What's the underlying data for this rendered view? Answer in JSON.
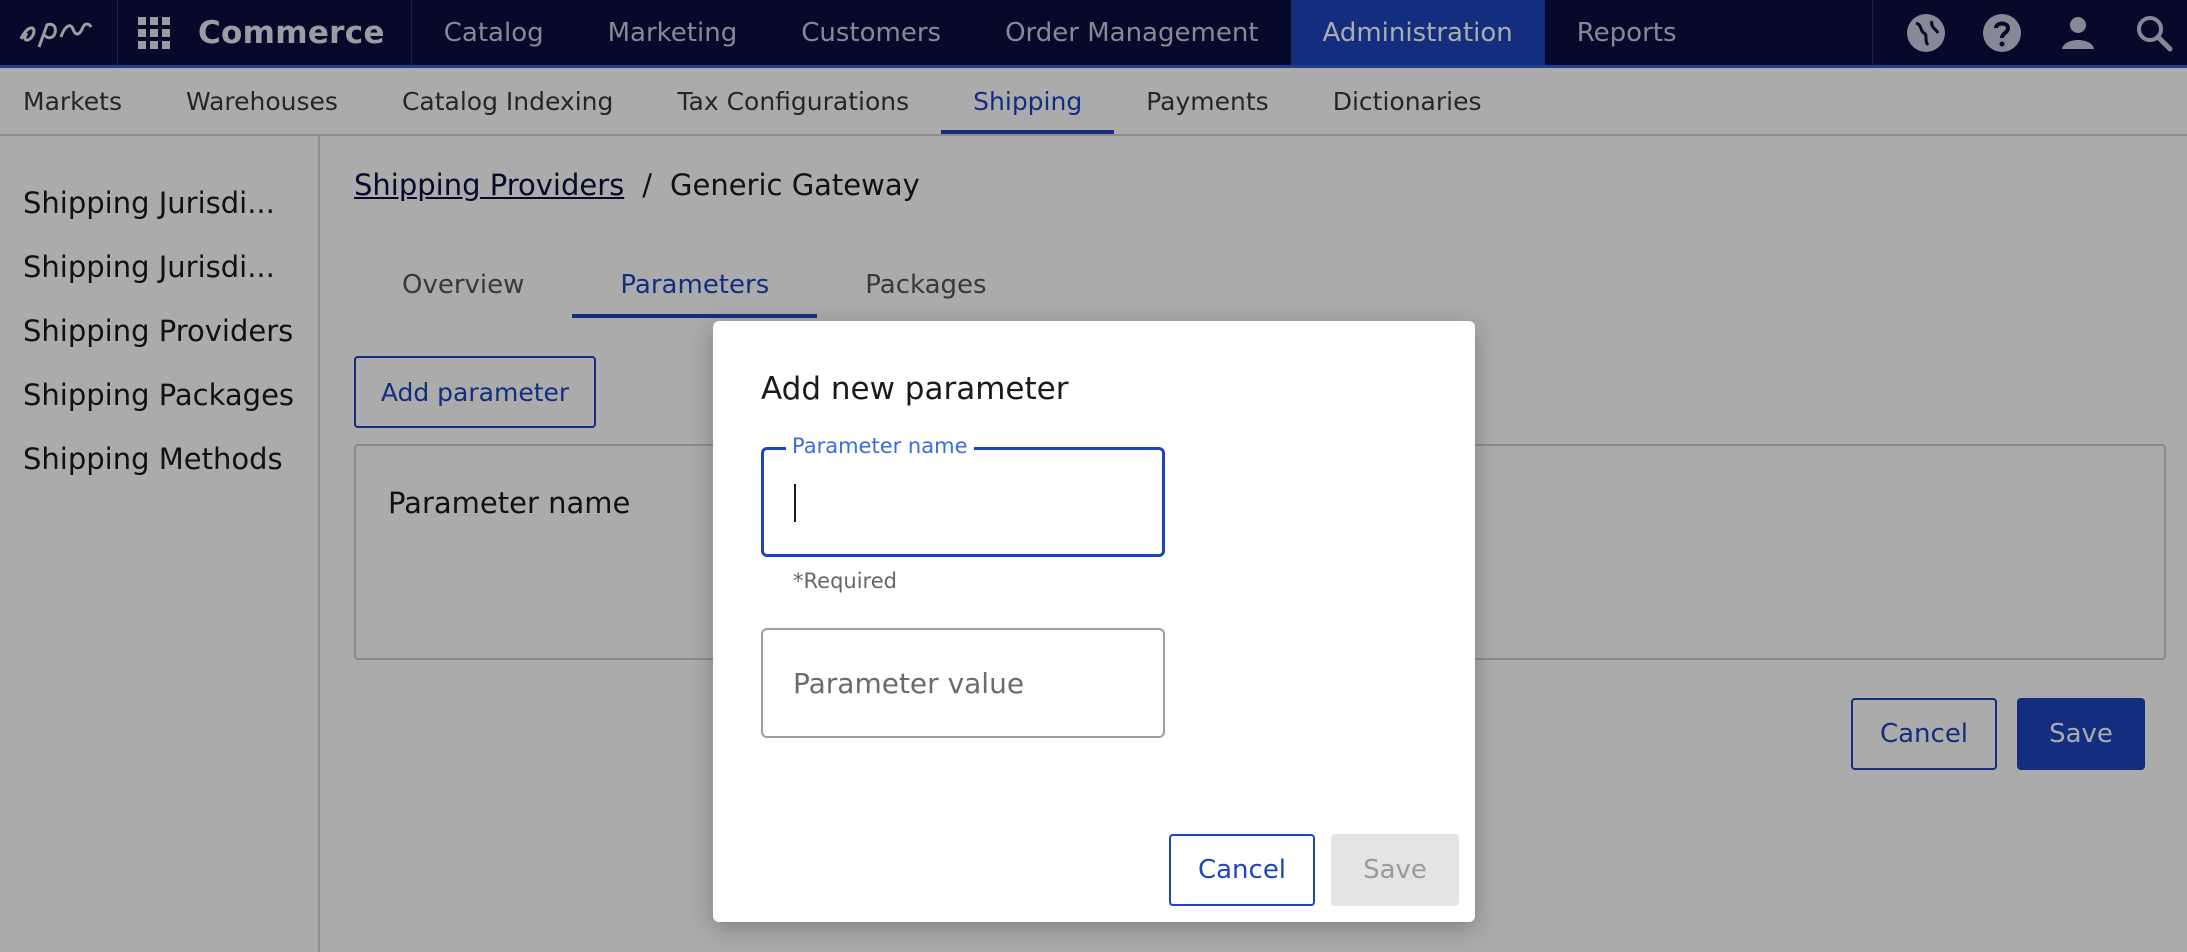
{
  "topbar": {
    "app_name": "Commerce",
    "nav": [
      "Catalog",
      "Marketing",
      "Customers",
      "Order Management",
      "Administration",
      "Reports"
    ],
    "active_nav": "Administration",
    "icons": [
      "globe-icon",
      "help-icon",
      "user-icon",
      "search-icon"
    ]
  },
  "subnav": {
    "items": [
      "Markets",
      "Warehouses",
      "Catalog Indexing",
      "Tax Configurations",
      "Shipping",
      "Payments",
      "Dictionaries"
    ],
    "active": "Shipping"
  },
  "sidebar": {
    "items": [
      "Shipping Jurisdi...",
      "Shipping Jurisdi...",
      "Shipping Providers",
      "Shipping Packages",
      "Shipping Methods"
    ]
  },
  "breadcrumb": {
    "parent": "Shipping Providers",
    "separator": "/",
    "current": "Generic Gateway"
  },
  "tabs": {
    "items": [
      "Overview",
      "Parameters",
      "Packages"
    ],
    "active": "Parameters"
  },
  "main": {
    "add_parameter_label": "Add parameter",
    "table_header": "Parameter name",
    "cancel_label": "Cancel",
    "save_label": "Save"
  },
  "dialog": {
    "title": "Add new parameter",
    "name_label": "Parameter name",
    "name_value": "",
    "name_helper": "*Required",
    "value_placeholder": "Parameter value",
    "cancel_label": "Cancel",
    "save_label": "Save"
  },
  "colors": {
    "topbar_bg": "#0b0e3f",
    "accent": "#1d45bd",
    "overlay": "rgba(0,0,0,0.33)"
  }
}
